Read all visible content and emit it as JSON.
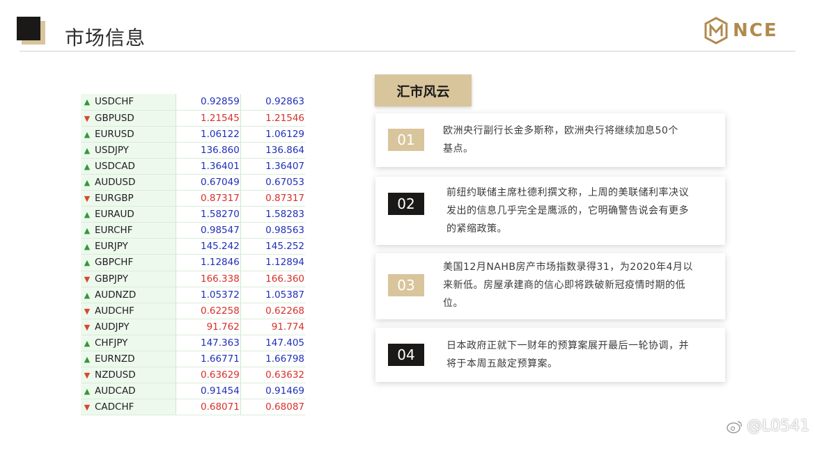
{
  "header": {
    "title": "市场信息",
    "logo_text": "NCE"
  },
  "rates": [
    {
      "symbol": "USDCHF",
      "dir": "up",
      "bid": "0.92859",
      "ask": "0.92863"
    },
    {
      "symbol": "GBPUSD",
      "dir": "down",
      "bid": "1.21545",
      "ask": "1.21546"
    },
    {
      "symbol": "EURUSD",
      "dir": "up",
      "bid": "1.06122",
      "ask": "1.06129"
    },
    {
      "symbol": "USDJPY",
      "dir": "up",
      "bid": "136.860",
      "ask": "136.864"
    },
    {
      "symbol": "USDCAD",
      "dir": "up",
      "bid": "1.36401",
      "ask": "1.36407"
    },
    {
      "symbol": "AUDUSD",
      "dir": "up",
      "bid": "0.67049",
      "ask": "0.67053"
    },
    {
      "symbol": "EURGBP",
      "dir": "down",
      "bid": "0.87317",
      "ask": "0.87317"
    },
    {
      "symbol": "EURAUD",
      "dir": "up",
      "bid": "1.58270",
      "ask": "1.58283"
    },
    {
      "symbol": "EURCHF",
      "dir": "up",
      "bid": "0.98547",
      "ask": "0.98563"
    },
    {
      "symbol": "EURJPY",
      "dir": "up",
      "bid": "145.242",
      "ask": "145.252"
    },
    {
      "symbol": "GBPCHF",
      "dir": "up",
      "bid": "1.12846",
      "ask": "1.12894"
    },
    {
      "symbol": "GBPJPY",
      "dir": "down",
      "bid": "166.338",
      "ask": "166.360"
    },
    {
      "symbol": "AUDNZD",
      "dir": "up",
      "bid": "1.05372",
      "ask": "1.05387"
    },
    {
      "symbol": "AUDCHF",
      "dir": "down",
      "bid": "0.62258",
      "ask": "0.62268"
    },
    {
      "symbol": "AUDJPY",
      "dir": "down",
      "bid": "91.762",
      "ask": "91.774"
    },
    {
      "symbol": "CHFJPY",
      "dir": "up",
      "bid": "147.363",
      "ask": "147.405"
    },
    {
      "symbol": "EURNZD",
      "dir": "up",
      "bid": "1.66771",
      "ask": "1.66798"
    },
    {
      "symbol": "NZDUSD",
      "dir": "down",
      "bid": "0.63629",
      "ask": "0.63632"
    },
    {
      "symbol": "AUDCAD",
      "dir": "up",
      "bid": "0.91454",
      "ask": "0.91469"
    },
    {
      "symbol": "CADCHF",
      "dir": "down",
      "bid": "0.68071",
      "ask": "0.68087"
    }
  ],
  "news": {
    "title": "汇市风云",
    "items": [
      {
        "num": "01",
        "style": "gold",
        "lines": [
          "欧洲央行副行长金多斯称，欧洲央行将继续加息50个",
          "基点。"
        ]
      },
      {
        "num": "02",
        "style": "dark",
        "lines": [
          "前纽约联储主席杜德利撰文称，上周的美联储利率决议",
          "发出的信息几乎完全是鹰派的，它明确警告说会有更多",
          "的紧缩政策。"
        ]
      },
      {
        "num": "03",
        "style": "gold",
        "lines": [
          "美国12月NAHB房产市场指数录得31，为2020年4月以",
          "来新低。房屋承建商的信心即将跌破新冠疫情时期的低",
          "位。"
        ]
      },
      {
        "num": "04",
        "style": "dark",
        "lines": [
          "日本政府正就下一财年的预算案展开最后一轮协调，并",
          "将于本周五敲定预算案。"
        ]
      }
    ]
  },
  "watermark": {
    "text": "@L0541"
  },
  "colors": {
    "gold": "#d9c59c",
    "dark": "#1b1918",
    "up": "#1f2fb8",
    "down": "#d6302a"
  }
}
